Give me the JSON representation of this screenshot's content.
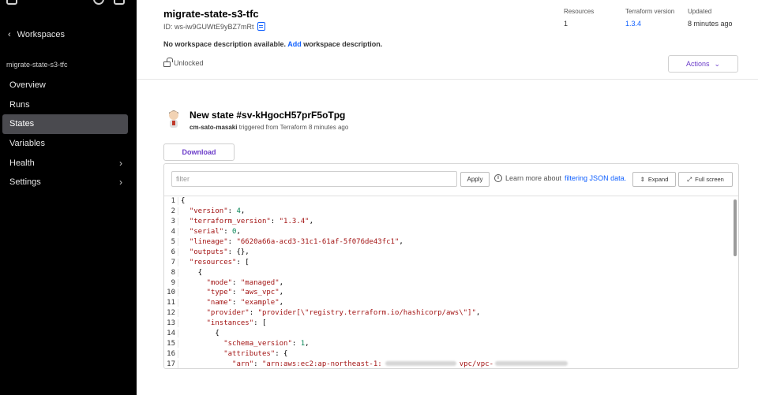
{
  "sidebar": {
    "back_label": "Workspaces",
    "workspace_name": "migrate-state-s3-tfc",
    "items": [
      {
        "label": "Overview",
        "has_chevron": false,
        "active": false
      },
      {
        "label": "Runs",
        "has_chevron": false,
        "active": false
      },
      {
        "label": "States",
        "has_chevron": false,
        "active": true
      },
      {
        "label": "Variables",
        "has_chevron": false,
        "active": false
      },
      {
        "label": "Health",
        "has_chevron": true,
        "active": false
      },
      {
        "label": "Settings",
        "has_chevron": true,
        "active": false
      }
    ]
  },
  "header": {
    "title": "migrate-state-s3-tfc",
    "id_text": "ID: ws-iw9GUWtE9yBZ7mRt",
    "meta": [
      {
        "label": "Resources",
        "value": "1"
      },
      {
        "label": "Terraform version",
        "value": "1.3.4"
      },
      {
        "label": "Updated",
        "value": "8 minutes ago"
      }
    ],
    "desc_prefix": "No workspace description available.",
    "desc_link": "Add",
    "desc_suffix": "workspace description.",
    "lock_status": "Unlocked",
    "actions_label": "Actions"
  },
  "state": {
    "title": "New state #sv-kHgocH57prF5oTpg",
    "user": "cm-sato-masaki",
    "triggered": "triggered from Terraform 8 minutes ago",
    "download_label": "Download"
  },
  "viewer": {
    "filter_placeholder": "filter",
    "apply_label": "Apply",
    "learn_prefix": "Learn more about",
    "learn_link": "filtering JSON data.",
    "expand_label": "Expand",
    "fullscreen_label": "Full screen"
  },
  "code_lines": [
    "{",
    "  \"version\": 4,",
    "  \"terraform_version\": \"1.3.4\",",
    "  \"serial\": 0,",
    "  \"lineage\": \"6620a66a-acd3-31c1-61af-5f076de43fc1\",",
    "  \"outputs\": {},",
    "  \"resources\": [",
    "    {",
    "      \"mode\": \"managed\",",
    "      \"type\": \"aws_vpc\",",
    "      \"name\": \"example\",",
    "      \"provider\": \"provider[\\\"registry.terraform.io/hashicorp/aws\\\"]\",",
    "      \"instances\": [",
    "        {",
    "          \"schema_version\": 1,",
    "          \"attributes\": {",
    "            \"arn\": \"arn:aws:ec2:ap-northeast-1:"
  ],
  "arn_tail": "vpc/vpc-"
}
